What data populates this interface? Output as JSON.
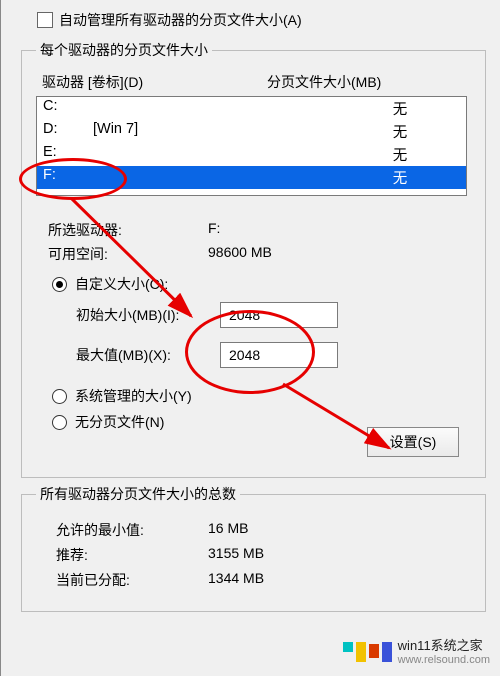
{
  "checkbox_auto": "自动管理所有驱动器的分页文件大小(A)",
  "group_per_drive": "每个驱动器的分页文件大小",
  "drive_header_left": "驱动器 [卷标](D)",
  "drive_header_right": "分页文件大小(MB)",
  "drives": [
    {
      "letter": "C:",
      "label": "",
      "size": "无"
    },
    {
      "letter": "D:",
      "label": "[Win 7]",
      "size": "无"
    },
    {
      "letter": "E:",
      "label": "",
      "size": "无"
    },
    {
      "letter": "F:",
      "label": "",
      "size": "无"
    }
  ],
  "selected_drive_label": "所选驱动器:",
  "selected_drive_value": "F:",
  "avail_space_label": "可用空间:",
  "avail_space_value": "98600 MB",
  "radio_custom": "自定义大小(C):",
  "initial_label": "初始大小(MB)(I):",
  "initial_value": "2048",
  "max_label": "最大值(MB)(X):",
  "max_value": "2048",
  "radio_system": "系统管理的大小(Y)",
  "radio_none": "无分页文件(N)",
  "set_button": "设置(S)",
  "group_totals": "所有驱动器分页文件大小的总数",
  "min_allowed_label": "允许的最小值:",
  "min_allowed_value": "16 MB",
  "recommended_label": "推荐:",
  "recommended_value": "3155 MB",
  "current_alloc_label": "当前已分配:",
  "current_alloc_value": "1344 MB",
  "watermark_text": "win11系统之家",
  "watermark_url": "www.relsound.com"
}
